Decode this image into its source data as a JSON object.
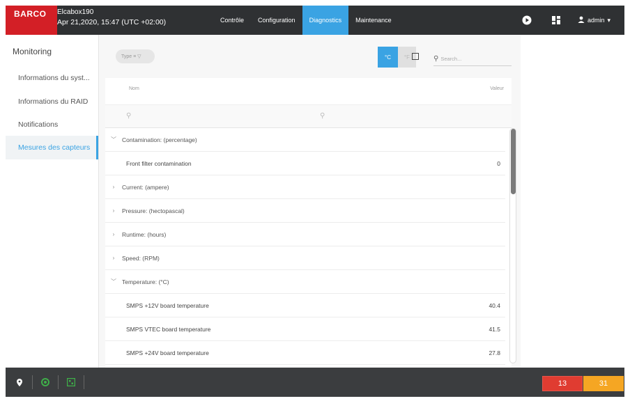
{
  "header": {
    "brand": "BARCO",
    "device_name": "Elcabox190",
    "datetime": "Apr 21,2020, 15:47 (UTC +02:00)",
    "tabs": [
      {
        "label": "Contrôle"
      },
      {
        "label": "Configuration"
      },
      {
        "label": "Diagnostics",
        "active": true
      },
      {
        "label": "Maintenance"
      }
    ],
    "user": "admin"
  },
  "sidebar": {
    "title": "Monitoring",
    "items": [
      {
        "label": "Informations du syst..."
      },
      {
        "label": "Informations du RAID"
      },
      {
        "label": "Notifications"
      },
      {
        "label": "Mesures des capteurs",
        "active": true
      }
    ]
  },
  "toolbar": {
    "type_chip": "Type ≡ ▽",
    "unit_celsius": "°C",
    "unit_fahrenheit": "°F",
    "search_placeholder": "Search..."
  },
  "table": {
    "col_name": "Nom",
    "col_value": "Valeur",
    "rows": [
      {
        "kind": "group",
        "expanded": true,
        "label": "Contamination: (percentage)"
      },
      {
        "kind": "child",
        "label": "Front filter contamination",
        "value": "0"
      },
      {
        "kind": "group",
        "expanded": false,
        "label": "Current: (ampere)"
      },
      {
        "kind": "group",
        "expanded": false,
        "label": "Pressure: (hectopascal)"
      },
      {
        "kind": "group",
        "expanded": false,
        "label": "Runtime: (hours)"
      },
      {
        "kind": "group",
        "expanded": false,
        "label": "Speed: (RPM)"
      },
      {
        "kind": "group",
        "expanded": true,
        "label": "Temperature: (°C)"
      },
      {
        "kind": "child",
        "label": "SMPS +12V board temperature",
        "value": "40.4"
      },
      {
        "kind": "child",
        "label": "SMPS VTEC board temperature",
        "value": "41.5"
      },
      {
        "kind": "child",
        "label": "SMPS +24V board temperature",
        "value": "27.8"
      }
    ]
  },
  "footer": {
    "errors_count": "13",
    "warnings_count": "31"
  },
  "colors": {
    "accent": "#3aa3e3",
    "brand_red": "#d31f26",
    "error_red": "#e03c31",
    "warning_orange": "#f5a623"
  }
}
